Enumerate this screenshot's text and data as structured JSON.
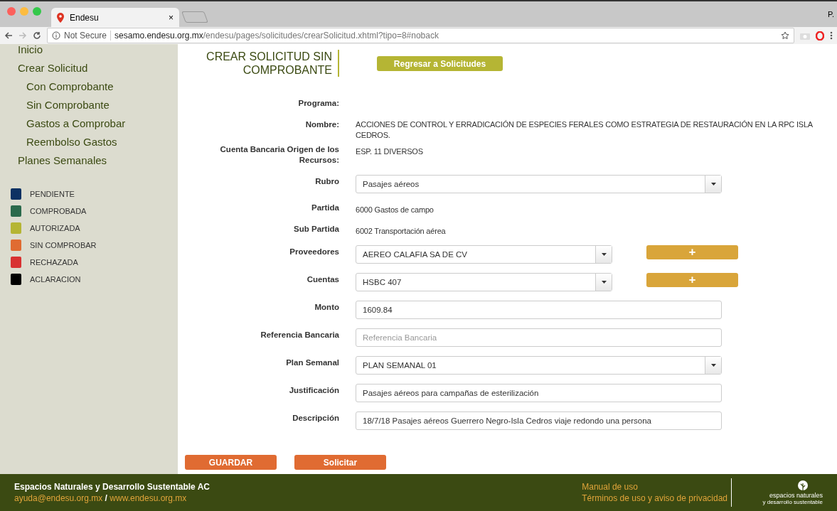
{
  "browser": {
    "tab_title": "Endesu",
    "tab_close": "×",
    "security": "Not Secure",
    "url_host": "sesamo.endesu.org.mx",
    "url_path": "/endesu/pages/solicitudes/crearSolicitud.xhtml?tipo=8#noback",
    "profile": "P."
  },
  "sidebar": {
    "items": [
      {
        "label": "Inicio"
      },
      {
        "label": "Crear Solicitud",
        "children": [
          {
            "label": "Con Comprobante"
          },
          {
            "label": "Sin Comprobante"
          },
          {
            "label": "Gastos a Comprobar"
          },
          {
            "label": "Reembolso Gastos"
          }
        ]
      },
      {
        "label": "Planes Semanales"
      }
    ],
    "legend": [
      {
        "label": "PENDIENTE",
        "color": "#0d3163"
      },
      {
        "label": "COMPROBADA",
        "color": "#2b6a4c"
      },
      {
        "label": "AUTORIZADA",
        "color": "#b5b534"
      },
      {
        "label": "SIN COMPROBAR",
        "color": "#e06b32"
      },
      {
        "label": "RECHAZADA",
        "color": "#d83131"
      },
      {
        "label": "ACLARACION",
        "color": "#000000"
      }
    ]
  },
  "header": {
    "title": "CREAR SOLICITUD SIN COMPROBANTE",
    "back_button": "Regresar a Solicitudes"
  },
  "form": {
    "rows": [
      {
        "kind": "text",
        "label": "Programa:"
      },
      {
        "kind": "text",
        "label": "Nombre:",
        "value": "ACCIONES DE CONTROL Y ERRADICACIÓN DE ESPECIES FERALES COMO ESTRATEGIA DE RESTAURACIÓN EN LA RPC ISLA CEDROS."
      },
      {
        "kind": "text",
        "label": "Cuenta Bancaria Origen de los Recursos:",
        "value": "ESP. 11 DIVERSOS"
      },
      {
        "kind": "select",
        "label": "Rubro",
        "value": "Pasajes aéreos"
      },
      {
        "kind": "text",
        "label": "Partida",
        "value": "6000 Gastos de campo"
      },
      {
        "kind": "text",
        "label": "Sub Partida",
        "value": "6002 Transportación aérea"
      },
      {
        "kind": "select_add",
        "label": "Proveedores",
        "value": "AEREO CALAFIA SA DE CV",
        "add": "+"
      },
      {
        "kind": "select_add",
        "label": "Cuentas",
        "value": "HSBC 407",
        "add": "+"
      },
      {
        "kind": "input",
        "label": "Monto",
        "value": "1609.84"
      },
      {
        "kind": "input",
        "label": "Referencia Bancaria",
        "placeholder": "Referencia Bancaria"
      },
      {
        "kind": "select",
        "label": "Plan Semanal",
        "value": "PLAN SEMANAL 01"
      },
      {
        "kind": "input",
        "label": "Justificación",
        "value": "Pasajes aéreos para campañas de esterilización"
      },
      {
        "kind": "input",
        "label": "Descripción",
        "value": "18/7/18 Pasajes aéreos Guerrero Negro-Isla Cedros viaje redondo una persona"
      }
    ],
    "buttons": [
      "GUARDAR",
      "Solicitar"
    ]
  },
  "footer": {
    "org": "Espacios Naturales y Desarrollo Sustentable AC",
    "email": "ayuda@endesu.org.mx",
    "separator": "/",
    "website": "www.endesu.org.mx",
    "links": [
      "Manual de uso",
      "Términos de uso y aviso de privacidad"
    ],
    "logo_line1": "espacios naturales",
    "logo_line2": "y desarrollo sustentable"
  }
}
